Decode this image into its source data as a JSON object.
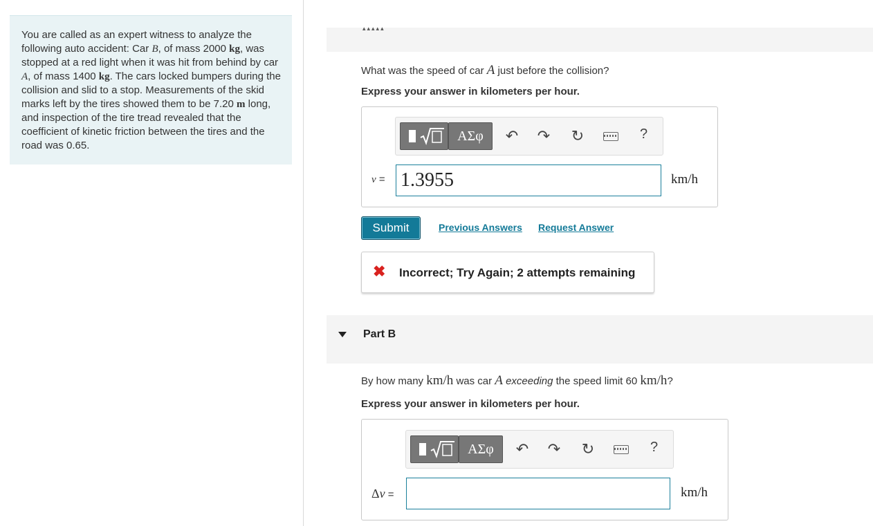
{
  "problem": {
    "text_1": "You are called as an expert witness to analyze the following auto accident: Car ",
    "car_b": "B",
    "text_2": ", of mass 2000 ",
    "unit_kg": "kg",
    "text_3": ", was stopped at a red light when it was hit from behind by car ",
    "car_a": "A",
    "text_4": ", of mass 1400 ",
    "text_5": ". The cars locked bumpers during the collision and slid to a stop. Measurements of the skid marks left by the tires showed them to be 7.20 ",
    "unit_m": "m",
    "text_6": " long, and inspection of the tire tread revealed that the coefficient of kinetic friction between the tires and the road was 0.65."
  },
  "partA": {
    "question_pre": "What was the speed of car ",
    "question_var": "A",
    "question_post": " just before the collision?",
    "instruction": "Express your answer in kilometers per hour.",
    "toolbar": {
      "greek_label": "ΑΣφ",
      "help_label": "?"
    },
    "var_symbol": "v",
    "var_eq": " =",
    "answer_value": "1.3955",
    "unit": "km/h",
    "submit_label": "Submit",
    "prev_answers_label": "Previous Answers",
    "request_answer_label": "Request Answer",
    "feedback_icon": "✖",
    "feedback_text": "Incorrect; Try Again; 2 attempts remaining"
  },
  "partB": {
    "title": "Part B",
    "question_pre": "By how many ",
    "question_unit1": "km/h",
    "question_mid": " was car ",
    "question_var": "A",
    "question_em": "exceeding",
    "question_mid2": " the speed limit 60 ",
    "question_unit2": "km/h",
    "question_post": "?",
    "instruction": "Express your answer in kilometers per hour.",
    "toolbar": {
      "greek_label": "ΑΣφ",
      "help_label": "?"
    },
    "var_delta": "Δ",
    "var_symbol": "v",
    "var_eq": " =",
    "answer_value": "",
    "unit": "km/h"
  },
  "colors": {
    "accent": "#137a98",
    "error": "#d9221f",
    "panel_bg": "#e9f3f5"
  }
}
